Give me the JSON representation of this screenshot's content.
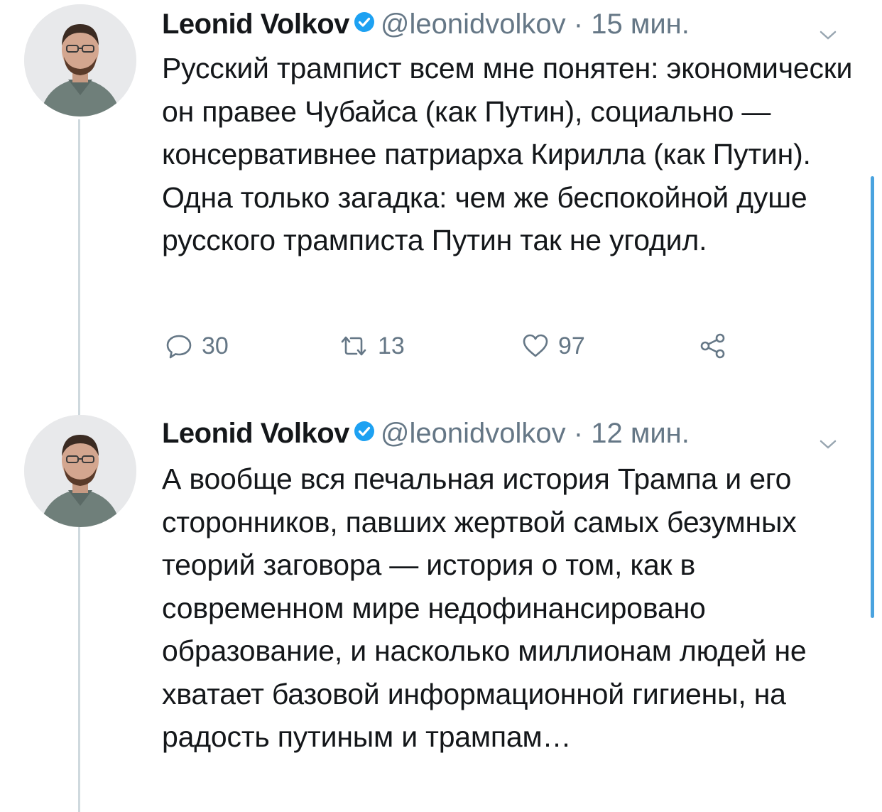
{
  "colors": {
    "text": "#14171a",
    "secondary": "#657786",
    "verified": "#1da1f2",
    "thread_line": "#cfd9de",
    "scrollbar": "#4aa3df"
  },
  "tweets": [
    {
      "author": "Leonid Volkov",
      "handle": "@leonidvolkov",
      "separator": "·",
      "time": "15 мин.",
      "verified": true,
      "avatar_icon": "profile-photo",
      "text": "Русский трампист всем мне понятен: экономически он правее Чубайса (как Путин), социально — консервативнее патриарха Кирилла (как Путин). Одна только загадка: чем же беспокойной душе русского трамписта Путин так не угодил.",
      "actions": {
        "reply": {
          "icon": "reply-icon",
          "count": "30"
        },
        "retweet": {
          "icon": "retweet-icon",
          "count": "13"
        },
        "like": {
          "icon": "heart-icon",
          "count": "97"
        },
        "share": {
          "icon": "share-icon"
        }
      }
    },
    {
      "author": "Leonid Volkov",
      "handle": "@leonidvolkov",
      "separator": "·",
      "time": "12 мин.",
      "verified": true,
      "avatar_icon": "profile-photo",
      "text": "А вообще вся печальная история Трампа и его сторонников, павших жертвой самых безумных теорий заговора — история о том, как в современном мире недофинансировано образование, и насколько миллионам людей не хватает базовой информационной гигиены, на радость путиным и трампам…"
    }
  ]
}
